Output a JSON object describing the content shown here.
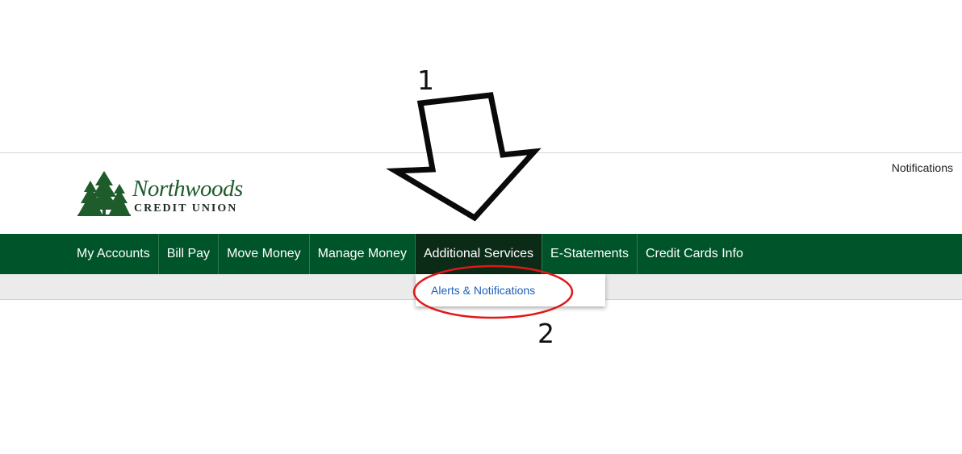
{
  "header": {
    "notifications_link": "Notifications"
  },
  "logo": {
    "name": "Northwoods",
    "subtitle": "CREDIT UNION",
    "icon": "pine-trees-icon"
  },
  "nav": {
    "items": [
      {
        "label": "My Accounts"
      },
      {
        "label": "Bill Pay"
      },
      {
        "label": "Move Money"
      },
      {
        "label": "Manage Money"
      },
      {
        "label": "Additional Services",
        "active": true
      },
      {
        "label": "E-Statements"
      },
      {
        "label": "Credit Cards Info"
      }
    ]
  },
  "dropdown": {
    "items": [
      {
        "label": "Alerts & Notifications"
      }
    ]
  },
  "annotations": {
    "step1": "1",
    "step2": "2"
  },
  "colors": {
    "nav_bg": "#00542a",
    "nav_active_bg": "#0c2b17",
    "link_blue": "#1f5fb8",
    "annotation_red": "#e01818"
  }
}
